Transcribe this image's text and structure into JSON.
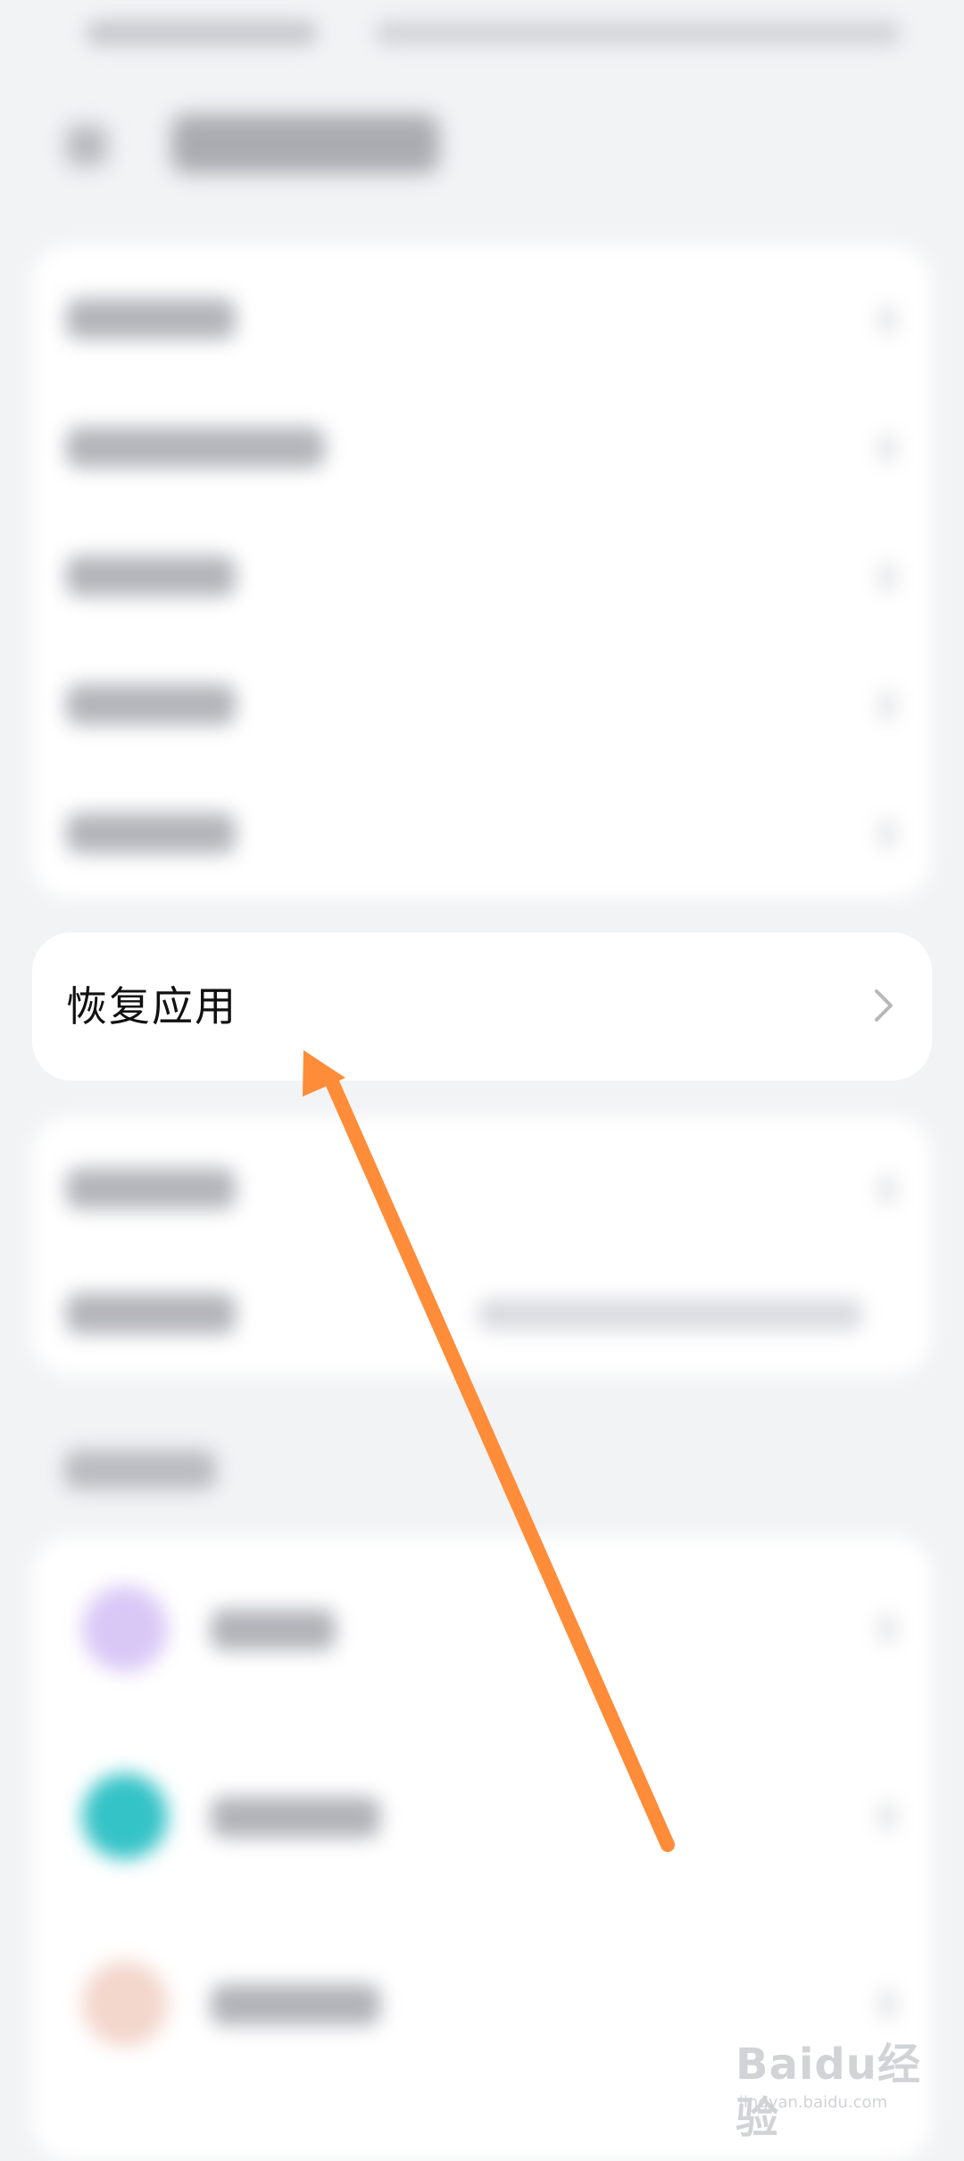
{
  "focus_item": {
    "label": "恢复应用"
  },
  "annotation": {
    "arrow_color": "#ff8c38"
  },
  "watermark": {
    "brand": "Baidu经验",
    "url": "jingyan.baidu.com"
  },
  "colors": {
    "background": "#f2f3f5",
    "card": "#ffffff",
    "text_primary": "#111111",
    "chevron": "#b8b8bc",
    "accent_purple": "#d9c8f6",
    "accent_teal": "#34c3c7",
    "accent_peach": "#f3d6cc"
  },
  "icons": {
    "back": "back-arrow-icon",
    "chevron": "chevron-right-icon"
  }
}
